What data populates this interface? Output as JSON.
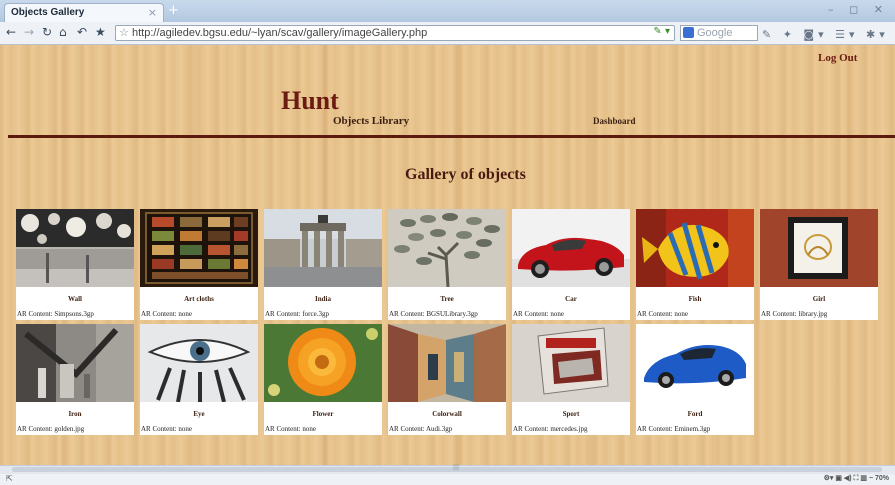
{
  "browser": {
    "tab_title": "Objects Gallery",
    "tab_close": "×",
    "new_tab": "+",
    "url": "http://agiledev.bgsu.edu/~lyan/scav/gallery/imageGallery.php",
    "search_placeholder": "Google",
    "zoom": "70%",
    "icons": [
      "back-icon",
      "forward-icon",
      "reload-icon",
      "home-icon",
      "undo-icon",
      "bookmark-star-icon"
    ]
  },
  "page": {
    "logout": "Log Out",
    "brand": "Hunt",
    "nav": {
      "library": "Objects Library",
      "dashboard": "Dashboard"
    },
    "gallery_title": "Gallery of objects"
  },
  "gallery": [
    {
      "name": "Wall",
      "ar": "AR Content: Simpsons.3gp"
    },
    {
      "name": "Art cloths",
      "ar": "AR Content: none"
    },
    {
      "name": "India",
      "ar": "AR Content: force.3gp"
    },
    {
      "name": "Tree",
      "ar": "AR Content: BGSULibrary.3gp"
    },
    {
      "name": "Car",
      "ar": "AR Content: none"
    },
    {
      "name": "Fish",
      "ar": "AR Content: none"
    },
    {
      "name": "Girl",
      "ar": "AR Content: library.jpg"
    },
    {
      "name": "Iron",
      "ar": "AR Content: golden.jpg"
    },
    {
      "name": "Eye",
      "ar": "AR Content: none"
    },
    {
      "name": "Flower",
      "ar": "AR Content: none"
    },
    {
      "name": "Colorwall",
      "ar": "AR Content: Audi.3gp"
    },
    {
      "name": "Sport",
      "ar": "AR Content: mercedes.jpg"
    },
    {
      "name": "Ford",
      "ar": "AR Content: Eminem.3gp"
    }
  ]
}
